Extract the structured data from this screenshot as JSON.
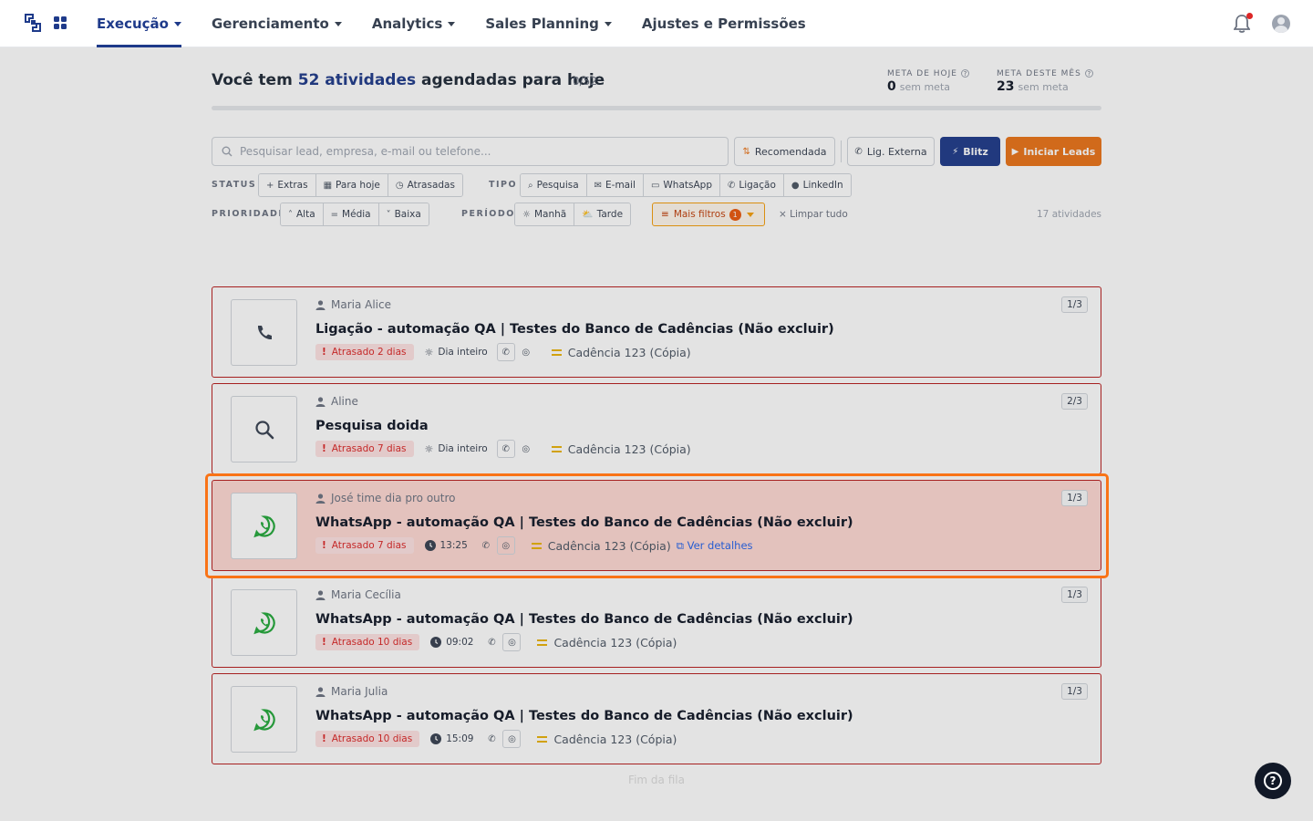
{
  "nav": {
    "items": [
      {
        "label": "Execução",
        "caret": true,
        "active": true
      },
      {
        "label": "Gerenciamento",
        "caret": true
      },
      {
        "label": "Analytics",
        "caret": true
      },
      {
        "label": "Sales Planning",
        "caret": true
      },
      {
        "label": "Ajustes e Permissões",
        "caret": false
      }
    ]
  },
  "header": {
    "prefix": "Você tem",
    "highlight": "52 atividades",
    "suffix": "agendadas para hoje",
    "counter": "0/52",
    "progress_fraction": 0
  },
  "metas": {
    "today": {
      "label": "META DE HOJE",
      "value": "0",
      "note": "sem meta"
    },
    "month": {
      "label": "META DESTE MÊS",
      "value": "23",
      "note": "sem meta"
    }
  },
  "search": {
    "placeholder": "Pesquisar lead, empresa, e-mail ou telefone..."
  },
  "toolbar": {
    "recomendada": "Recomendada",
    "lig_externa": "Lig. Externa",
    "blitz": "Blitz",
    "iniciar_leads": "Iniciar Leads"
  },
  "filters": {
    "status_label": "STATUS",
    "status": [
      "Extras",
      "Para hoje",
      "Atrasadas"
    ],
    "tipo_label": "TIPO",
    "tipo": [
      "Pesquisa",
      "E-mail",
      "WhatsApp",
      "Ligação",
      "LinkedIn"
    ],
    "prioridade_label": "PRIORIDADE",
    "prioridade": [
      "Alta",
      "Média",
      "Baixa"
    ],
    "periodo_label": "PERÍODO",
    "periodo": [
      "Manhã",
      "Tarde"
    ],
    "mais_filtros": "Mais filtros",
    "mais_filtros_count": "1",
    "limpar": "Limpar tudo",
    "count": "17 atividades"
  },
  "cards": [
    {
      "icon": "phone",
      "name": "",
      "title": "",
      "step": "",
      "late": "Atrasado 2 dias",
      "when": "Dia inteiro",
      "when_icon": "sun",
      "cadence": "Cadência 123 (Cópia)",
      "details": ""
    },
    {
      "icon": "phone",
      "name": "Maria Alice",
      "title": "Ligação - automação QA | Testes do Banco de Cadências (Não excluir)",
      "step": "1/3",
      "late": "Atrasado 2 dias",
      "when": "Dia inteiro",
      "when_icon": "sun",
      "cadence": "Cadência 123 (Cópia)",
      "details": ""
    },
    {
      "icon": "search",
      "name": "Aline",
      "title": "Pesquisa doida",
      "step": "2/3",
      "late": "Atrasado 7 dias",
      "when": "Dia inteiro",
      "when_icon": "sun",
      "cadence": "Cadência 123 (Cópia)",
      "details": ""
    },
    {
      "icon": "whatsapp",
      "name": "José time dia pro outro",
      "title": "WhatsApp - automação QA | Testes do Banco de Cadências (Não excluir)",
      "step": "1/3",
      "late": "Atrasado 7 dias",
      "when": "13:25",
      "when_icon": "clock",
      "cadence": "Cadência 123 (Cópia)",
      "details": "Ver detalhes",
      "focus": true
    },
    {
      "icon": "whatsapp",
      "name": "Maria Cecília",
      "title": "WhatsApp - automação QA | Testes do Banco de Cadências (Não excluir)",
      "step": "1/3",
      "late": "Atrasado 10 dias",
      "when": "09:02",
      "when_icon": "clock",
      "cadence": "Cadência 123 (Cópia)",
      "details": ""
    },
    {
      "icon": "whatsapp",
      "name": "Maria Julia",
      "title": "WhatsApp - automação QA | Testes do Banco de Cadências (Não excluir)",
      "step": "1/3",
      "late": "Atrasado 10 dias",
      "when": "15:09",
      "when_icon": "clock",
      "cadence": "Cadência 123 (Cópia)",
      "details": ""
    }
  ],
  "footer": {
    "end": "Fim da fila"
  },
  "colors": {
    "brand": "#1e3a8a",
    "accent": "#ea7317",
    "danger": "#b91c1c",
    "whatsapp": "#22a83a"
  }
}
